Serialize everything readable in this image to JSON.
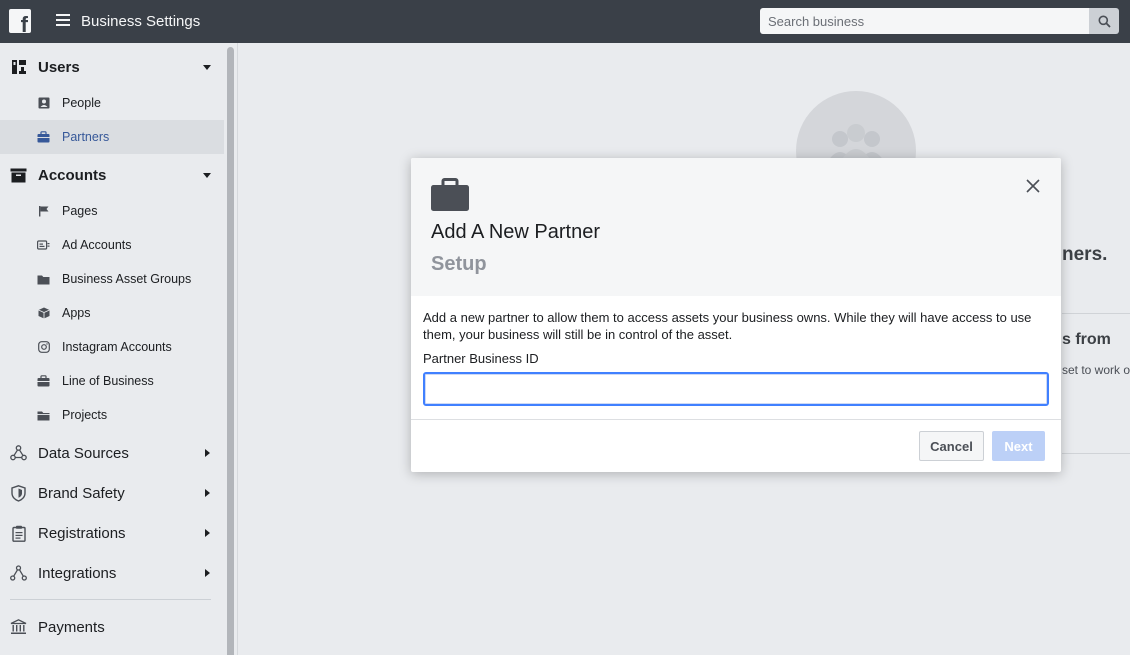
{
  "header": {
    "app_title": "Business Settings",
    "search_placeholder": "Search business",
    "logo_letter": "f"
  },
  "sidebar": {
    "sections": [
      {
        "label": "Users",
        "icon": "users-icon",
        "expanded": true,
        "items": [
          {
            "label": "People",
            "icon": "person-icon",
            "active": false
          },
          {
            "label": "Partners",
            "icon": "briefcase-icon",
            "active": true
          }
        ]
      },
      {
        "label": "Accounts",
        "icon": "archive-icon",
        "expanded": true,
        "items": [
          {
            "label": "Pages",
            "icon": "flag-icon",
            "active": false
          },
          {
            "label": "Ad Accounts",
            "icon": "ad-account-icon",
            "active": false
          },
          {
            "label": "Business Asset Groups",
            "icon": "folder-icon",
            "active": false
          },
          {
            "label": "Apps",
            "icon": "cube-icon",
            "active": false
          },
          {
            "label": "Instagram Accounts",
            "icon": "instagram-icon",
            "active": false
          },
          {
            "label": "Line of Business",
            "icon": "briefcase-icon",
            "active": false
          },
          {
            "label": "Projects",
            "icon": "folder-icon",
            "active": false
          }
        ]
      },
      {
        "label": "Data Sources",
        "icon": "data-sources-icon",
        "expanded": false
      },
      {
        "label": "Brand Safety",
        "icon": "shield-icon",
        "expanded": false
      },
      {
        "label": "Registrations",
        "icon": "clipboard-icon",
        "expanded": false
      },
      {
        "label": "Integrations",
        "icon": "integrations-icon",
        "expanded": false
      },
      {
        "label": "Payments",
        "icon": "bank-icon",
        "expanded": false
      }
    ]
  },
  "background": {
    "heading_fragment": "ners.",
    "subheading_fragment": "s from",
    "text_fragment": "set to work o"
  },
  "modal": {
    "title": "Add A New Partner",
    "subtitle": "Setup",
    "description": "Add a new partner to allow them to access assets your business owns. While they will have access to use them, your business will still be in control of the asset.",
    "field_label": "Partner Business ID",
    "field_value": "",
    "cancel_label": "Cancel",
    "next_label": "Next"
  },
  "colors": {
    "topbar": "#3a4048",
    "accent": "#4080ff",
    "active_link": "#365899",
    "next_disabled": "#bcd0f7"
  }
}
